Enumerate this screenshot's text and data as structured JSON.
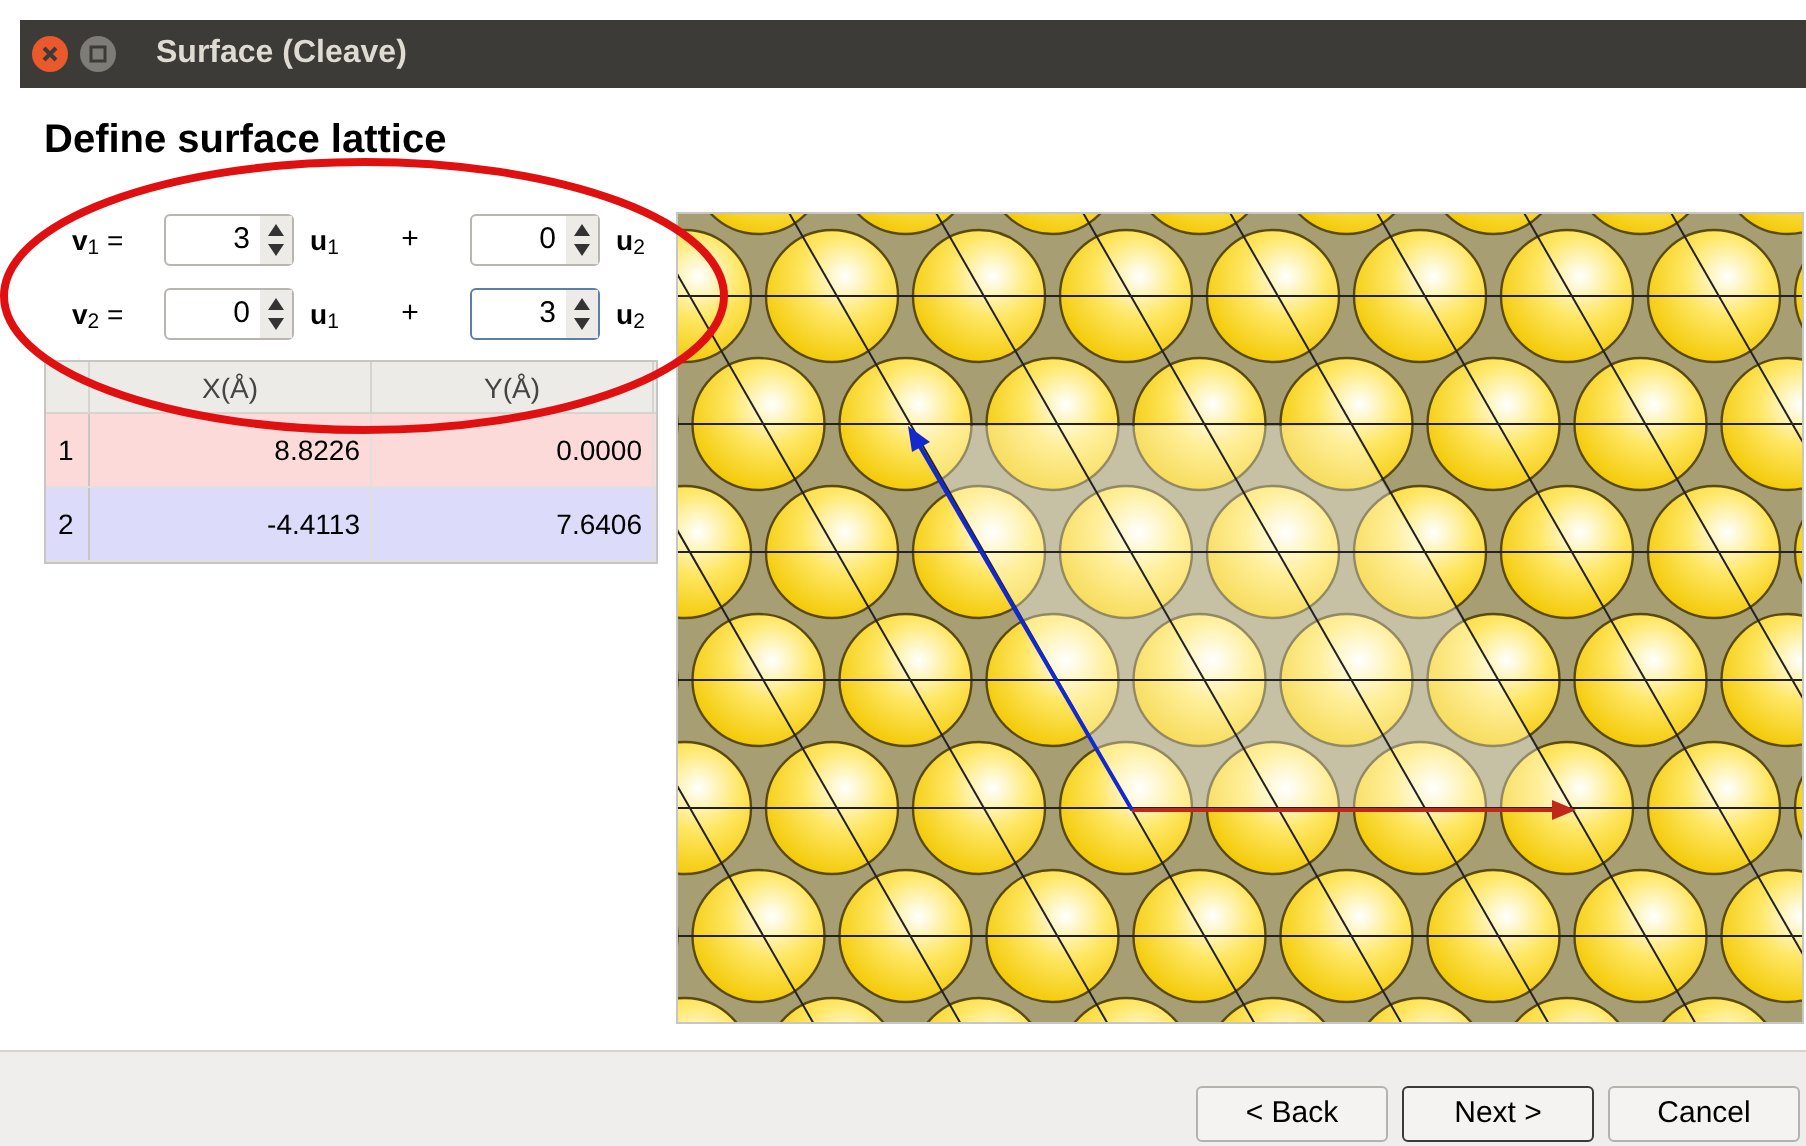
{
  "window": {
    "title": "Surface (Cleave)"
  },
  "heading": "Define surface lattice",
  "vectors": [
    {
      "label": "**v**$_{1}$ =",
      "terms": [
        {
          "value": "3",
          "focused": false,
          "unit": "**u**$_{1}$"
        },
        {
          "value": "0",
          "focused": false,
          "unit": "**u**$_{2}$"
        }
      ],
      "plus": "+"
    },
    {
      "label": "**v**$_{2}$ =",
      "terms": [
        {
          "value": "0",
          "focused": false,
          "unit": "**u**$_{1}$"
        },
        {
          "value": "3",
          "focused": true,
          "unit": "**u**$_{2}$"
        }
      ],
      "plus": "+"
    }
  ],
  "table": {
    "columns": [
      "X(Å)",
      "Y(Å)"
    ],
    "rows": [
      {
        "index": "1",
        "color": "#fddada",
        "cells": [
          "8.8226",
          "0.0000"
        ]
      },
      {
        "index": "2",
        "color": "#dcdcfa",
        "cells": [
          "-4.4113",
          "7.6406"
        ]
      }
    ]
  },
  "buttons": [
    {
      "label": "< Back",
      "default": false
    },
    {
      "label": "Next >",
      "default": true
    },
    {
      "label": "Cancel",
      "default": false
    }
  ]
}
